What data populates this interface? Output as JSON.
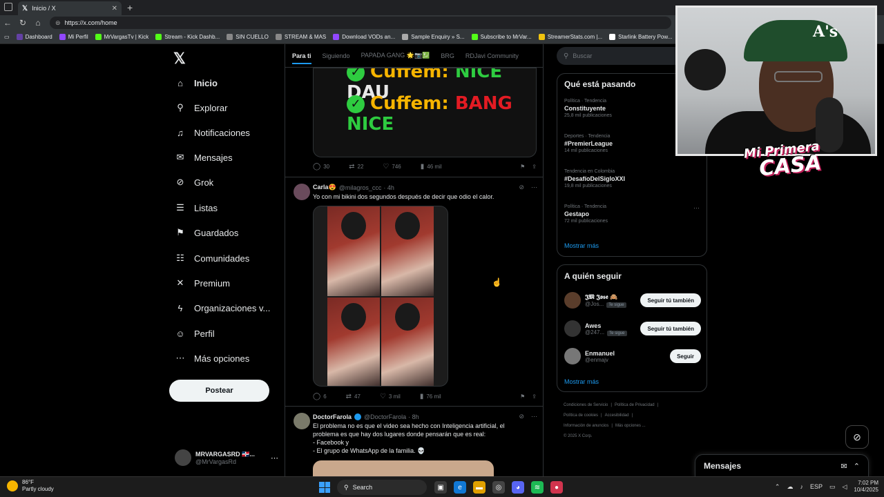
{
  "browser": {
    "tab_title": "Inicio / X",
    "url": "https://x.com/home",
    "bookmarks": [
      {
        "label": "Dashboard",
        "color": "#6441a5"
      },
      {
        "label": "Mi Perfil",
        "color": "#9147ff"
      },
      {
        "label": "MrVargasTv | Kick",
        "color": "#53fc18"
      },
      {
        "label": "Stream - Kick Dashb...",
        "color": "#53fc18"
      },
      {
        "label": "SIN CUELLO",
        "color": "#888888"
      },
      {
        "label": "STREAM & MAS",
        "color": "#888888"
      },
      {
        "label": "Download VODs an...",
        "color": "#9147ff"
      },
      {
        "label": "Sample Enquiry » S...",
        "color": "#aaaaaa"
      },
      {
        "label": "Subscribe to MrVar...",
        "color": "#53fc18"
      },
      {
        "label": "StreamerStats.com |...",
        "color": "#f1c40f"
      },
      {
        "label": "Starlink Battery Pow...",
        "color": "#ffffff"
      }
    ]
  },
  "nav": {
    "items": [
      {
        "label": "Inicio",
        "icon": "home-icon",
        "glyph": "⌂"
      },
      {
        "label": "Explorar",
        "icon": "search-icon",
        "glyph": "⚲"
      },
      {
        "label": "Notificaciones",
        "icon": "bell-icon",
        "glyph": "♫"
      },
      {
        "label": "Mensajes",
        "icon": "mail-icon",
        "glyph": "✉"
      },
      {
        "label": "Grok",
        "icon": "grok-icon",
        "glyph": "⊘"
      },
      {
        "label": "Listas",
        "icon": "list-icon",
        "glyph": "☰"
      },
      {
        "label": "Guardados",
        "icon": "bookmark-icon",
        "glyph": "⚑"
      },
      {
        "label": "Comunidades",
        "icon": "communities-icon",
        "glyph": "☷"
      },
      {
        "label": "Premium",
        "icon": "x-icon",
        "glyph": "✕"
      },
      {
        "label": "Organizaciones v...",
        "icon": "lightning-icon",
        "glyph": "ϟ"
      },
      {
        "label": "Perfil",
        "icon": "person-icon",
        "glyph": "☺"
      },
      {
        "label": "Más opciones",
        "icon": "more-circle-icon",
        "glyph": "⋯"
      }
    ],
    "post_label": "Postear",
    "account_name": "MRVARGASRD 🇩🇴...",
    "account_handle": "@MrVargasRd"
  },
  "timeline": {
    "tabs": [
      "Para ti",
      "Siguiendo",
      "PAPADA GANG 🌟📷💹",
      "BRG",
      "RDJavi Community"
    ],
    "meme": {
      "line1_a": "Cuffem:",
      "line1_b": "NICE",
      "line1_c": "DAU",
      "line2_a": "Cuffem:",
      "line2_b": "BANG",
      "line2_c": "NICE"
    },
    "tweet1_actions": {
      "replies": "30",
      "reposts": "22",
      "likes": "746",
      "views": "46 mil"
    },
    "tweet2": {
      "name": "Carla😍",
      "handle": "@milagros_ccc",
      "time": "· 4h",
      "text": "Yo con mi bikini dos segundos después de decir que odio el calor.",
      "actions": {
        "replies": "6",
        "reposts": "47",
        "likes": "3 mil",
        "views": "76 mil"
      }
    },
    "tweet3": {
      "name": "DoctorFarola",
      "handle": "@DoctorFarola",
      "time": "· 8h",
      "line1": "El problema no es que el video sea hecho con Inteligencia artificial, el",
      "line2": "problema es que hay dos lugares donde pensarán que es real:",
      "line3": "- Facebook y",
      "line4": "- El grupo de WhatsApp de la familia. 💀"
    }
  },
  "right": {
    "search_placeholder": "Buscar",
    "trends_title": "Qué está pasando",
    "trends": [
      {
        "context": "Política · Tendencia",
        "name": "Constituyente",
        "posts": "25,8 mil publicaciones"
      },
      {
        "context": "Deportes · Tendencia",
        "name": "#PremierLeague",
        "posts": "14 mil publicaciones"
      },
      {
        "context": "Tendencia en Colombia",
        "name": "#DesafíoDelSigloXXI",
        "posts": "19,8 mil publicaciones"
      },
      {
        "context": "Política · Tendencia",
        "name": "Gestapo",
        "posts": "72 mil publicaciones"
      }
    ],
    "show_more": "Mostrar más",
    "follow_title": "A quién seguir",
    "follow": [
      {
        "name": "𝕵𝕸 𝕵𝖔𝖘𝖊 🙈",
        "handle": "@Jos...",
        "badge": "Te sigue",
        "button": "Seguir tú también"
      },
      {
        "name": "Awes",
        "handle": "@247...",
        "badge": "Te sigue",
        "button": "Seguir tú también"
      },
      {
        "name": "Enmanuel",
        "handle": "@enmajv",
        "badge": "",
        "button": "Seguir"
      }
    ],
    "show_more2": "Mostrar más",
    "footer": {
      "l1a": "Condiciones de Servicio",
      "l1b": "Política de Privacidad",
      "l2a": "Política de cookies",
      "l2b": "Accesibilidad",
      "l3a": "Información de anuncios",
      "l3b": "Más opciones ...",
      "l4": "© 2025 X Corp."
    },
    "messages_drawer": "Mensajes"
  },
  "overlay": {
    "cap_letter": "A's",
    "logo_line1": "Mi Primera",
    "logo_line2": "CASA"
  },
  "taskbar": {
    "temp": "86°F",
    "weather": "Partly cloudy",
    "search": "Search",
    "lang": "ESP",
    "time": "7:02 PM",
    "date": "10/4/2025"
  }
}
